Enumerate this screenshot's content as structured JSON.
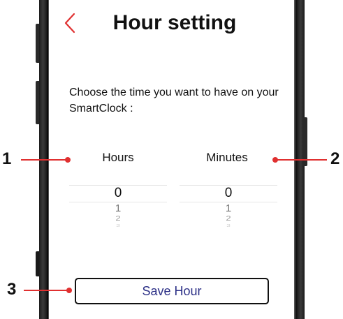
{
  "header": {
    "back_icon": "chevron-left-icon",
    "title": "Hour setting"
  },
  "instructions": "Choose the time you want to have on your SmartClock :",
  "hours": {
    "label": "Hours",
    "selected": "0",
    "options": [
      "0",
      "1",
      "2",
      "3"
    ]
  },
  "minutes": {
    "label": "Minutes",
    "selected": "0",
    "options": [
      "0",
      "1",
      "2",
      "3"
    ]
  },
  "save_button": {
    "label": "Save Hour"
  },
  "callouts": {
    "hours": "1",
    "minutes": "2",
    "save": "3"
  },
  "colors": {
    "accent_red": "#e03030",
    "button_text": "#2b2f86",
    "text": "#111111"
  }
}
